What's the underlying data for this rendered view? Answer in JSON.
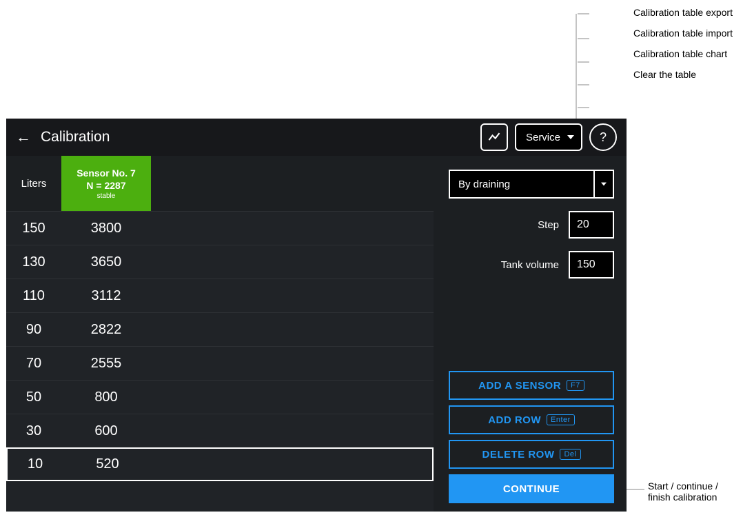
{
  "annotations": {
    "export": "Calibration table export",
    "import": "Calibration table import",
    "chart": "Calibration table chart",
    "clear": "Clear the table",
    "continue": "Start / continue / finish calibration"
  },
  "header": {
    "title": "Calibration",
    "service_label": "Service"
  },
  "table": {
    "liters_label": "Liters",
    "sensor": {
      "name": "Sensor No. 7",
      "n_value": "N = 2287",
      "status": "stable"
    },
    "rows": [
      {
        "liters": "150",
        "value": "3800",
        "selected": false
      },
      {
        "liters": "130",
        "value": "3650",
        "selected": false
      },
      {
        "liters": "110",
        "value": "3112",
        "selected": false
      },
      {
        "liters": "90",
        "value": "2822",
        "selected": false
      },
      {
        "liters": "70",
        "value": "2555",
        "selected": false
      },
      {
        "liters": "50",
        "value": "800",
        "selected": false
      },
      {
        "liters": "30",
        "value": "600",
        "selected": false
      },
      {
        "liters": "10",
        "value": "520",
        "selected": true
      }
    ]
  },
  "settings": {
    "mode": "By draining",
    "step_label": "Step",
    "step_value": "20",
    "tank_label": "Tank volume",
    "tank_value": "150"
  },
  "actions": {
    "add_sensor": "ADD A SENSOR",
    "add_sensor_key": "F7",
    "add_row": "ADD ROW",
    "add_row_key": "Enter",
    "delete_row": "DELETE ROW",
    "delete_row_key": "Del",
    "continue": "CONTINUE"
  }
}
